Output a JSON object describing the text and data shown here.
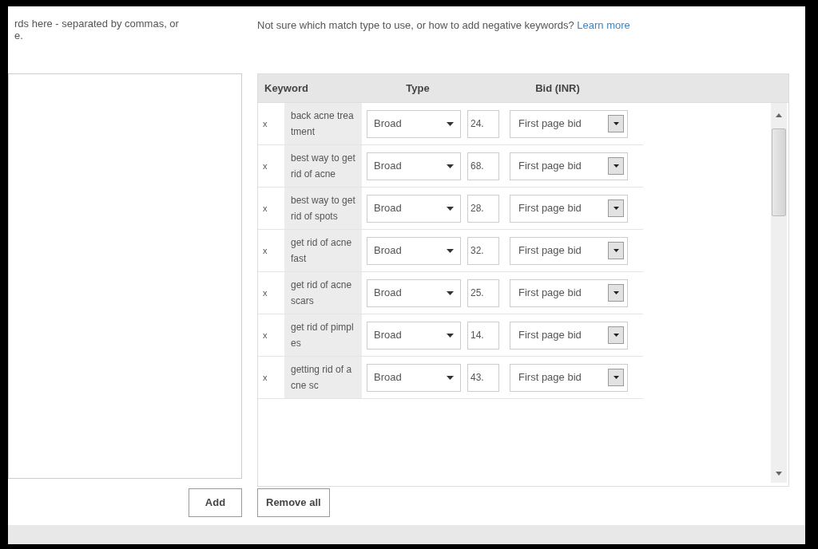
{
  "instructions": {
    "lines": [
      "rds here - separated by commas, or",
      "e."
    ]
  },
  "help": {
    "text": "Not sure which match type to use, or how to add negative keywords?",
    "link": "Learn more"
  },
  "table": {
    "columns": [
      "Keyword",
      "Type",
      "Bid (INR)"
    ],
    "rows": [
      {
        "remove": "x",
        "keyword": "back acne treatment",
        "match_type": "Broad",
        "bid": "24.",
        "bid_option": "First page bid"
      },
      {
        "remove": "x",
        "keyword": "best way to get rid of acne",
        "match_type": "Broad",
        "bid": "68.",
        "bid_option": "First page bid"
      },
      {
        "remove": "x",
        "keyword": "best way to get rid of spots",
        "match_type": "Broad",
        "bid": "28.",
        "bid_option": "First page bid"
      },
      {
        "remove": "x",
        "keyword": "get rid of acne fast",
        "match_type": "Broad",
        "bid": "32.",
        "bid_option": "First page bid"
      },
      {
        "remove": "x",
        "keyword": "get rid of acne scars",
        "match_type": "Broad",
        "bid": "25.",
        "bid_option": "First page bid"
      },
      {
        "remove": "x",
        "keyword": "get rid of pimples",
        "match_type": "Broad",
        "bid": "14.",
        "bid_option": "First page bid"
      },
      {
        "remove": "x",
        "keyword": "getting rid of acne sc",
        "match_type": "Broad",
        "bid": "43.",
        "bid_option": "First page bid"
      }
    ]
  },
  "buttons": {
    "add": "Add",
    "remove_all": "Remove all"
  }
}
